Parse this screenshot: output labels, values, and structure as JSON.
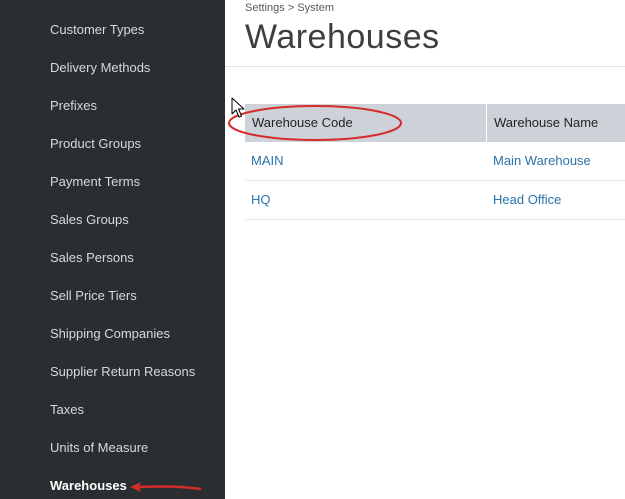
{
  "sidebar": {
    "items": [
      {
        "label": "Customer Types"
      },
      {
        "label": "Delivery Methods"
      },
      {
        "label": "Prefixes"
      },
      {
        "label": "Product Groups"
      },
      {
        "label": "Payment Terms"
      },
      {
        "label": "Sales Groups"
      },
      {
        "label": "Sales Persons"
      },
      {
        "label": "Sell Price Tiers"
      },
      {
        "label": "Shipping Companies"
      },
      {
        "label": "Supplier Return Reasons"
      },
      {
        "label": "Taxes"
      },
      {
        "label": "Units of Measure"
      },
      {
        "label": "Warehouses",
        "active": true
      }
    ]
  },
  "breadcrumb": {
    "parent": "Settings",
    "separator": ">",
    "current": "System"
  },
  "page": {
    "title": "Warehouses"
  },
  "table": {
    "columns": [
      "Warehouse Code",
      "Warehouse Name"
    ],
    "rows": [
      {
        "code": "MAIN",
        "name": "Main Warehouse"
      },
      {
        "code": "HQ",
        "name": "Head Office"
      }
    ]
  },
  "colors": {
    "sidebar_bg": "#2a2e30",
    "header_bg": "#ccd2d7",
    "link": "#2a74a8",
    "annotation": "#d42b2b"
  }
}
